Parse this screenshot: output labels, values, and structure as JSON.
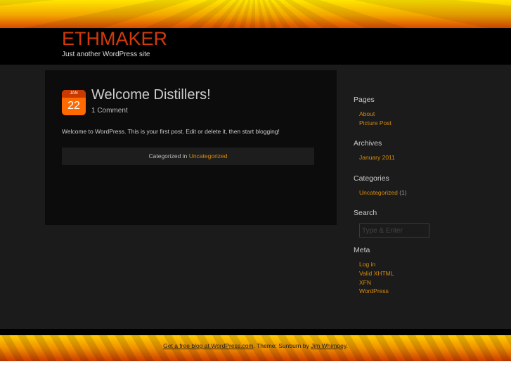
{
  "site": {
    "title": "ETHMAKER",
    "tagline": "Just another WordPress site"
  },
  "post": {
    "month": "JAN",
    "day": "22",
    "title": "Welcome Distillers!",
    "comments": "1 Comment",
    "body": "Welcome to WordPress. This is your first post. Edit or delete it, then start blogging!",
    "cat_prefix": "Categorized in",
    "category": "Uncategorized"
  },
  "sidebar": {
    "pages": {
      "heading": "Pages",
      "items": [
        "About",
        "Picture Post"
      ]
    },
    "archives": {
      "heading": "Archives",
      "items": [
        "January 2011"
      ]
    },
    "categories": {
      "heading": "Categories",
      "items": [
        {
          "label": "Uncategorized",
          "count": "(1)"
        }
      ]
    },
    "search": {
      "heading": "Search",
      "placeholder": "Type & Enter"
    },
    "meta": {
      "heading": "Meta",
      "items": [
        "Log in",
        "Valid XHTML",
        "XFN",
        "WordPress"
      ]
    }
  },
  "footer": {
    "link1": "Get a free blog at WordPress.com",
    "mid": ". Theme: Sunburn by ",
    "link2": "Jim Whimpey",
    "end": "."
  }
}
